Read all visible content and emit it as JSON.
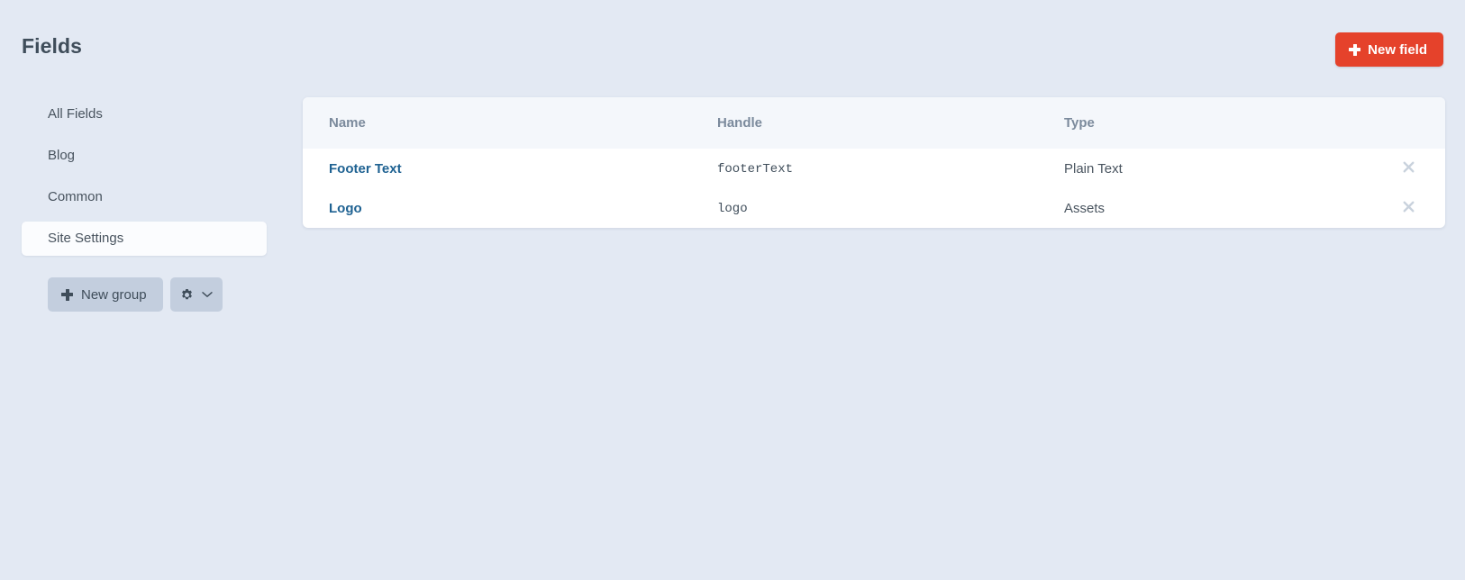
{
  "header": {
    "title": "Fields",
    "new_field_button": {
      "label": "New field",
      "icon": "plus-icon",
      "color": "#e5422b"
    }
  },
  "sidebar": {
    "items": [
      {
        "label": "All Fields",
        "selected": false
      },
      {
        "label": "Blog",
        "selected": false
      },
      {
        "label": "Common",
        "selected": false
      },
      {
        "label": "Site Settings",
        "selected": true
      }
    ],
    "actions": {
      "new_group_label": "New group",
      "new_group_icon": "plus-icon",
      "settings_icon": "gear-icon",
      "dropdown_icon": "chevron-down-icon"
    }
  },
  "table": {
    "columns": [
      {
        "key": "name",
        "label": "Name"
      },
      {
        "key": "handle",
        "label": "Handle"
      },
      {
        "key": "type",
        "label": "Type"
      }
    ],
    "rows": [
      {
        "name": "Footer Text",
        "handle": "footerText",
        "type": "Plain Text",
        "delete_icon": "close-icon"
      },
      {
        "name": "Logo",
        "handle": "logo",
        "type": "Assets",
        "delete_icon": "close-icon"
      }
    ]
  },
  "theme": {
    "page_background": "#e3e9f3",
    "card_background": "#ffffff",
    "table_header_background": "#f4f7fb",
    "link_color": "#1f6292",
    "accent_color": "#e5422b",
    "secondary_button_color": "#c3cede"
  }
}
